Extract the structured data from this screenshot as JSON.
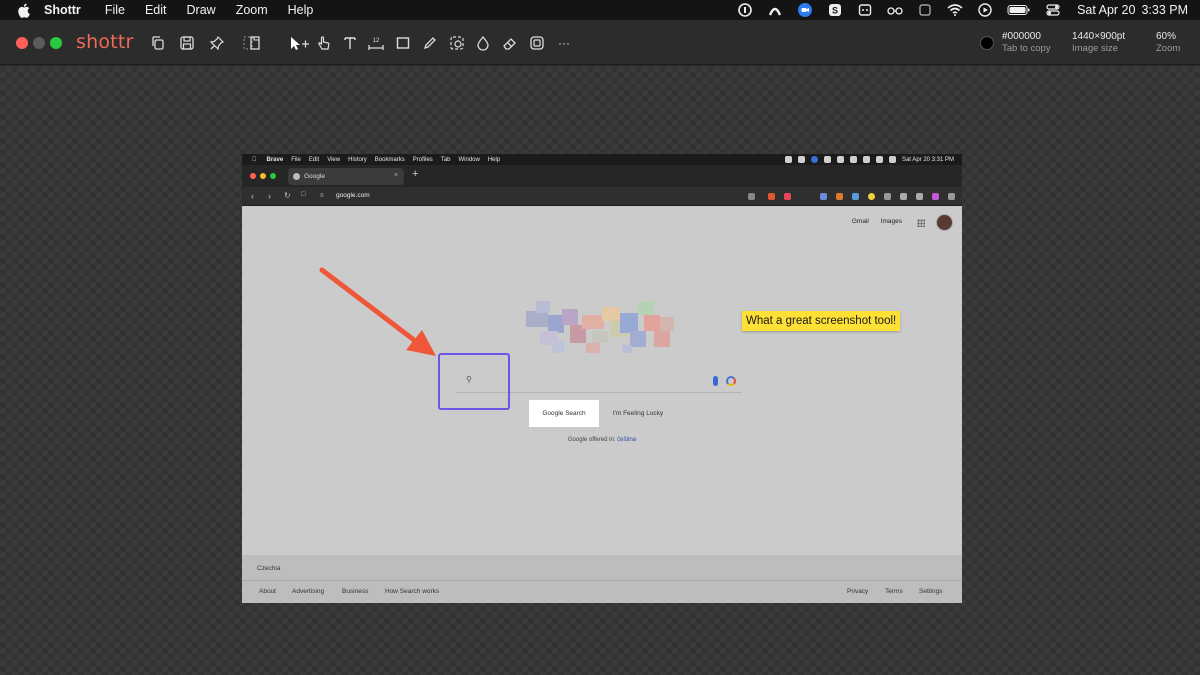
{
  "menubar": {
    "app_name": "Shottr",
    "items": [
      "File",
      "Edit",
      "Draw",
      "Zoom",
      "Help"
    ],
    "date": "Sat Apr 20",
    "time": "3:33 PM"
  },
  "toolbar": {
    "brand": "shottr",
    "color_hex": "#000000",
    "color_hint": "Tab to copy",
    "image_size": "1440×900pt",
    "image_size_label": "Image size",
    "zoom": "60%",
    "zoom_label": "Zoom",
    "more_label": "···"
  },
  "screenshot": {
    "menubar": {
      "app_name": "Brave",
      "items": [
        "File",
        "Edit",
        "View",
        "History",
        "Bookmarks",
        "Profiles",
        "Tab",
        "Window",
        "Help"
      ],
      "datetime": "Sat Apr 20  3:31 PM"
    },
    "tab_title": "Google",
    "tab_close": "×",
    "new_tab": "+",
    "url": "google.com",
    "top_links": [
      "Gmail",
      "Images"
    ],
    "search_button": "Google Search",
    "lucky_button": "I'm Feeling Lucky",
    "offered_in": "Google offered in:",
    "offered_language": "čeština",
    "footer_country": "Czechia",
    "footer_left": [
      "About",
      "Advertising",
      "Business",
      "How Search works"
    ],
    "footer_right": [
      "Privacy",
      "Terms",
      "Settings"
    ]
  },
  "annotations": {
    "note_text": "What a great screenshot tool!",
    "arrow_color": "#f0573a",
    "rect_color": "#6b56e8"
  }
}
